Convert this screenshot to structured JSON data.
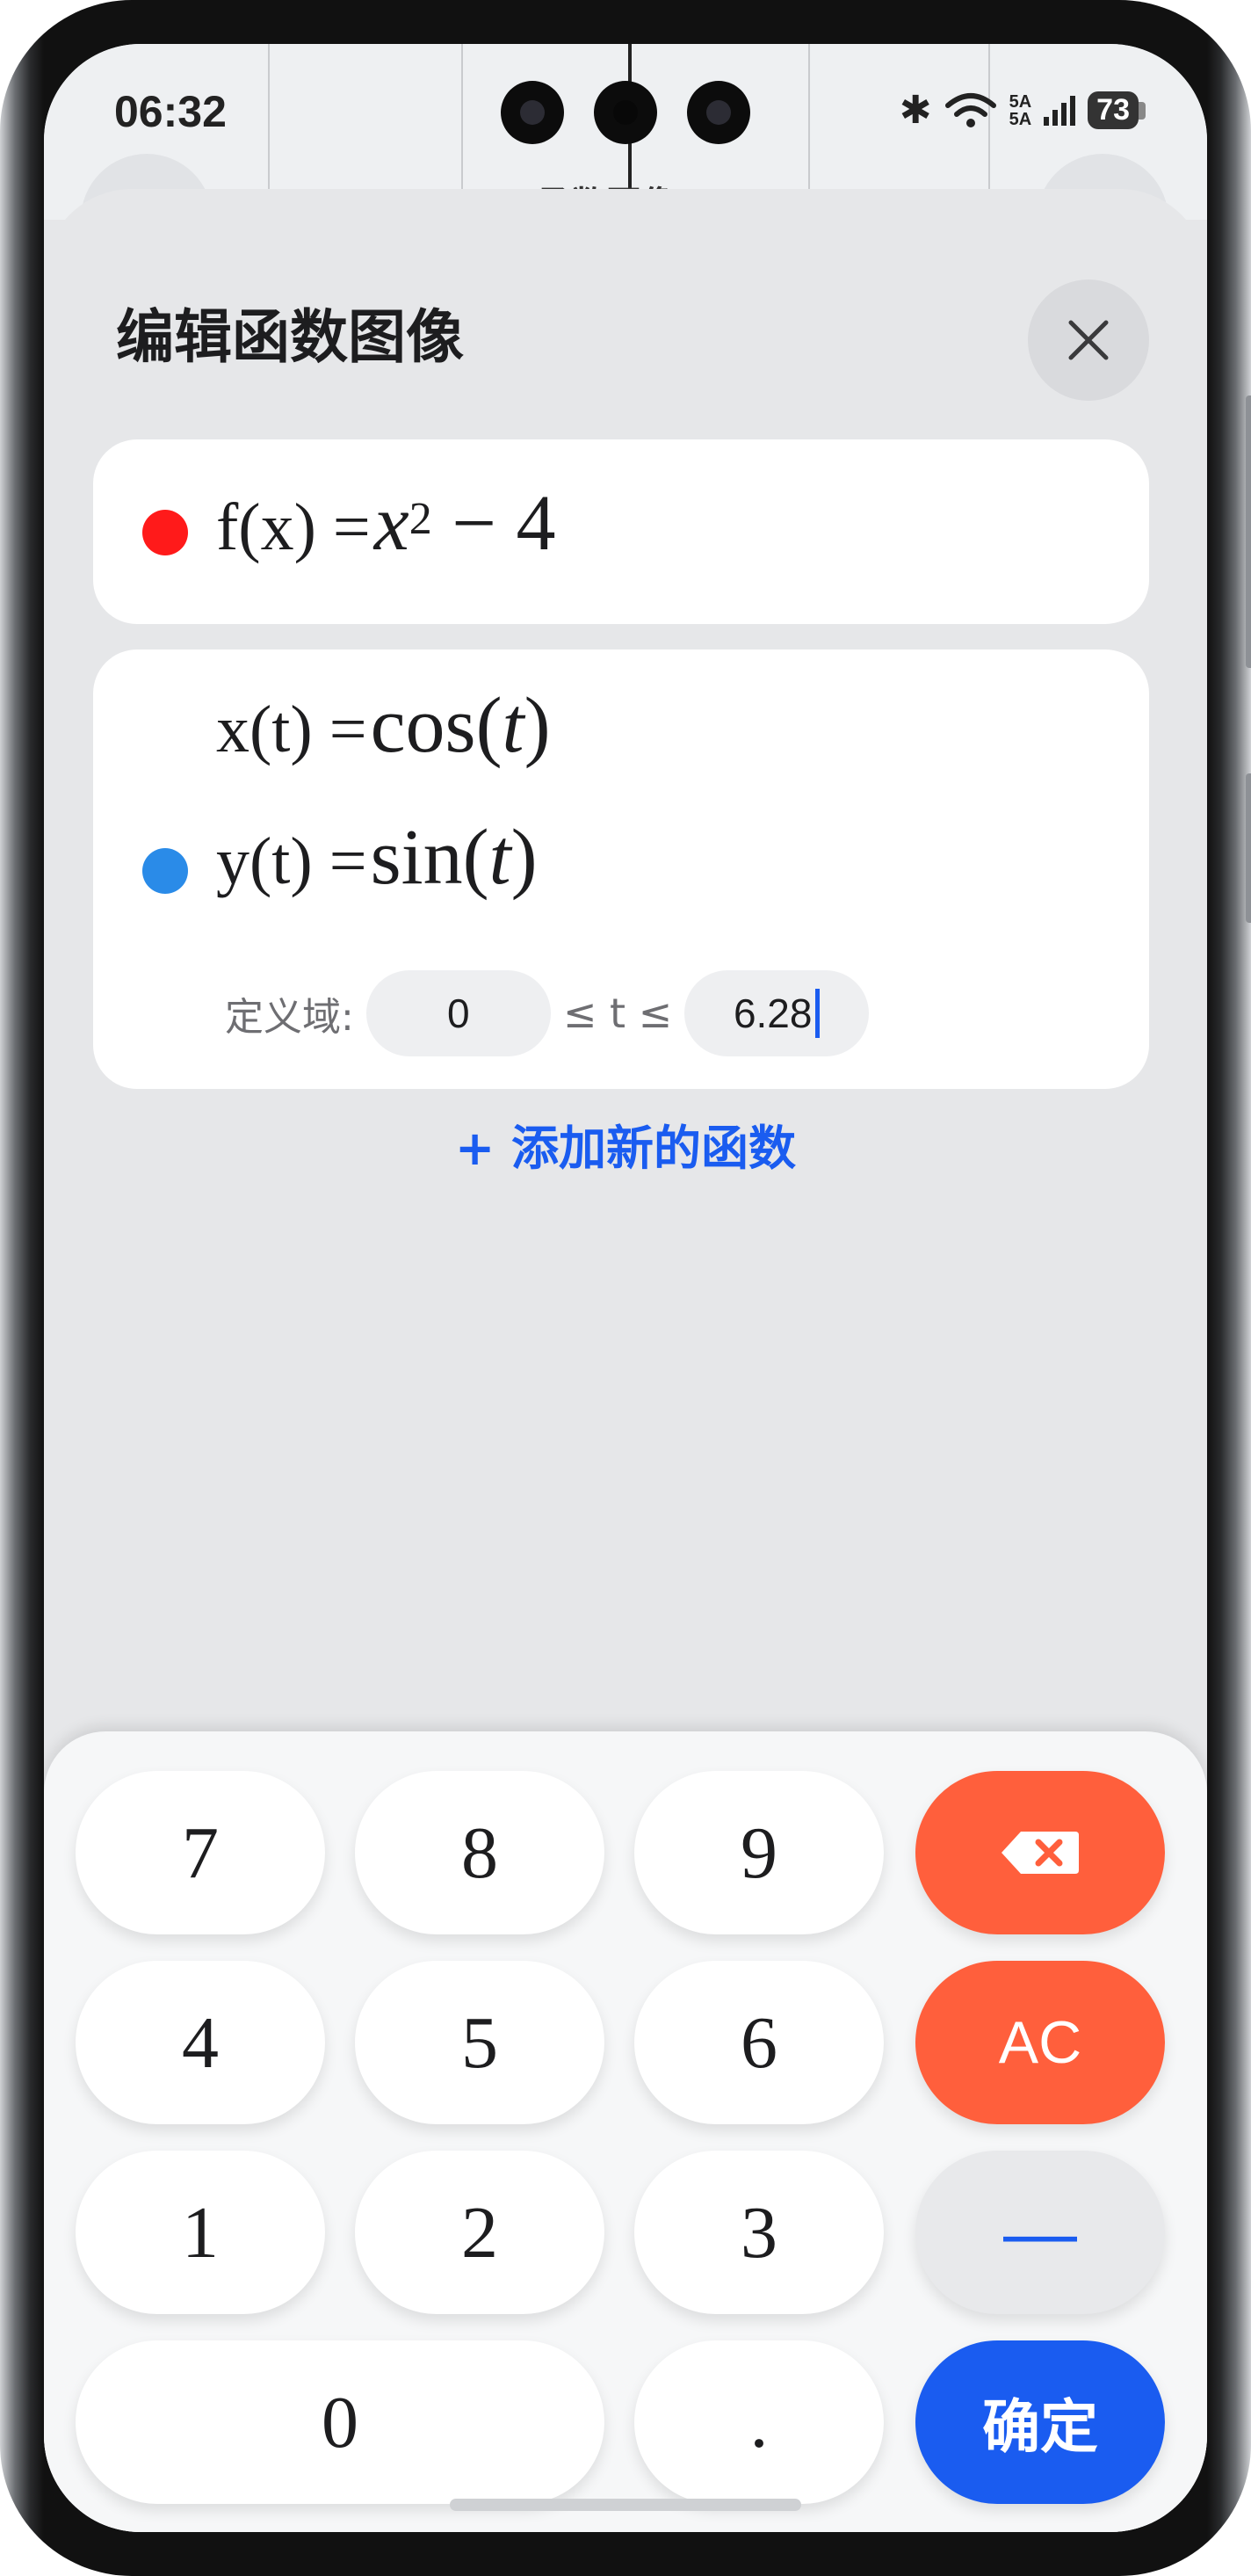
{
  "status_bar": {
    "time": "06:32",
    "network_label_1": "5A",
    "network_label_2": "5A",
    "battery": "73"
  },
  "background_app": {
    "title": "函数图像"
  },
  "sheet": {
    "title": "编辑函数图像"
  },
  "functions": [
    {
      "color": "#ff1a1a",
      "lhs": "f(x) =",
      "var": "x",
      "exp": "2",
      "rest": " − 4"
    },
    {
      "color": "#2a8be8",
      "x_lhs": "x(t) =",
      "x_fn": "cos(",
      "x_arg": "t",
      "x_close": ")",
      "y_lhs": "y(t) =",
      "y_fn": "sin(",
      "y_arg": "t",
      "y_close": ")",
      "domain_label": "定义域:",
      "domain_min": "0",
      "domain_sep": "≤ t ≤",
      "domain_max": "6.28"
    }
  ],
  "add_function_label": "+ 添加新的函数",
  "keypad": {
    "keys": [
      "7",
      "8",
      "9",
      "4",
      "5",
      "6",
      "1",
      "2",
      "3",
      "0",
      "."
    ],
    "clear_label": "AC",
    "minus_label": "—",
    "confirm_label": "确定",
    "backspace_icon": "backspace-icon"
  },
  "colors": {
    "accent_blue": "#1a5cf0",
    "delete_orange": "#ff5f3c"
  }
}
